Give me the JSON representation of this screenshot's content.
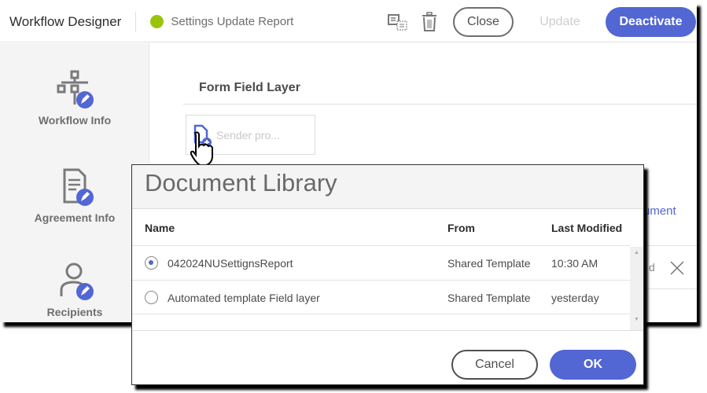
{
  "header": {
    "title": "Workflow Designer",
    "document_name": "Settings Update Report",
    "status_color": "#9ac40c",
    "close_label": "Close",
    "update_label": "Update",
    "deactivate_label": "Deactivate"
  },
  "sidebar": {
    "items": [
      {
        "label": "Workflow Info",
        "icon": "workflow-icon"
      },
      {
        "label": "Agreement Info",
        "icon": "agreement-icon"
      },
      {
        "label": "Recipients",
        "icon": "recipients-icon"
      }
    ]
  },
  "main": {
    "section_title": "Form Field Layer",
    "field_placeholder": "Sender pro...",
    "partial_link": "ument",
    "partial_text": "d"
  },
  "dialog": {
    "title": "Document Library",
    "columns": [
      "Name",
      "From",
      "Last Modified"
    ],
    "rows": [
      {
        "name": "042024NUSettignsReport",
        "from": "Shared Template",
        "modified": "10:30 AM",
        "selected": true
      },
      {
        "name": "Automated template Field layer",
        "from": "Shared Template",
        "modified": "yesterday",
        "selected": false
      }
    ],
    "cancel_label": "Cancel",
    "ok_label": "OK"
  },
  "colors": {
    "accent": "#5266d4"
  }
}
